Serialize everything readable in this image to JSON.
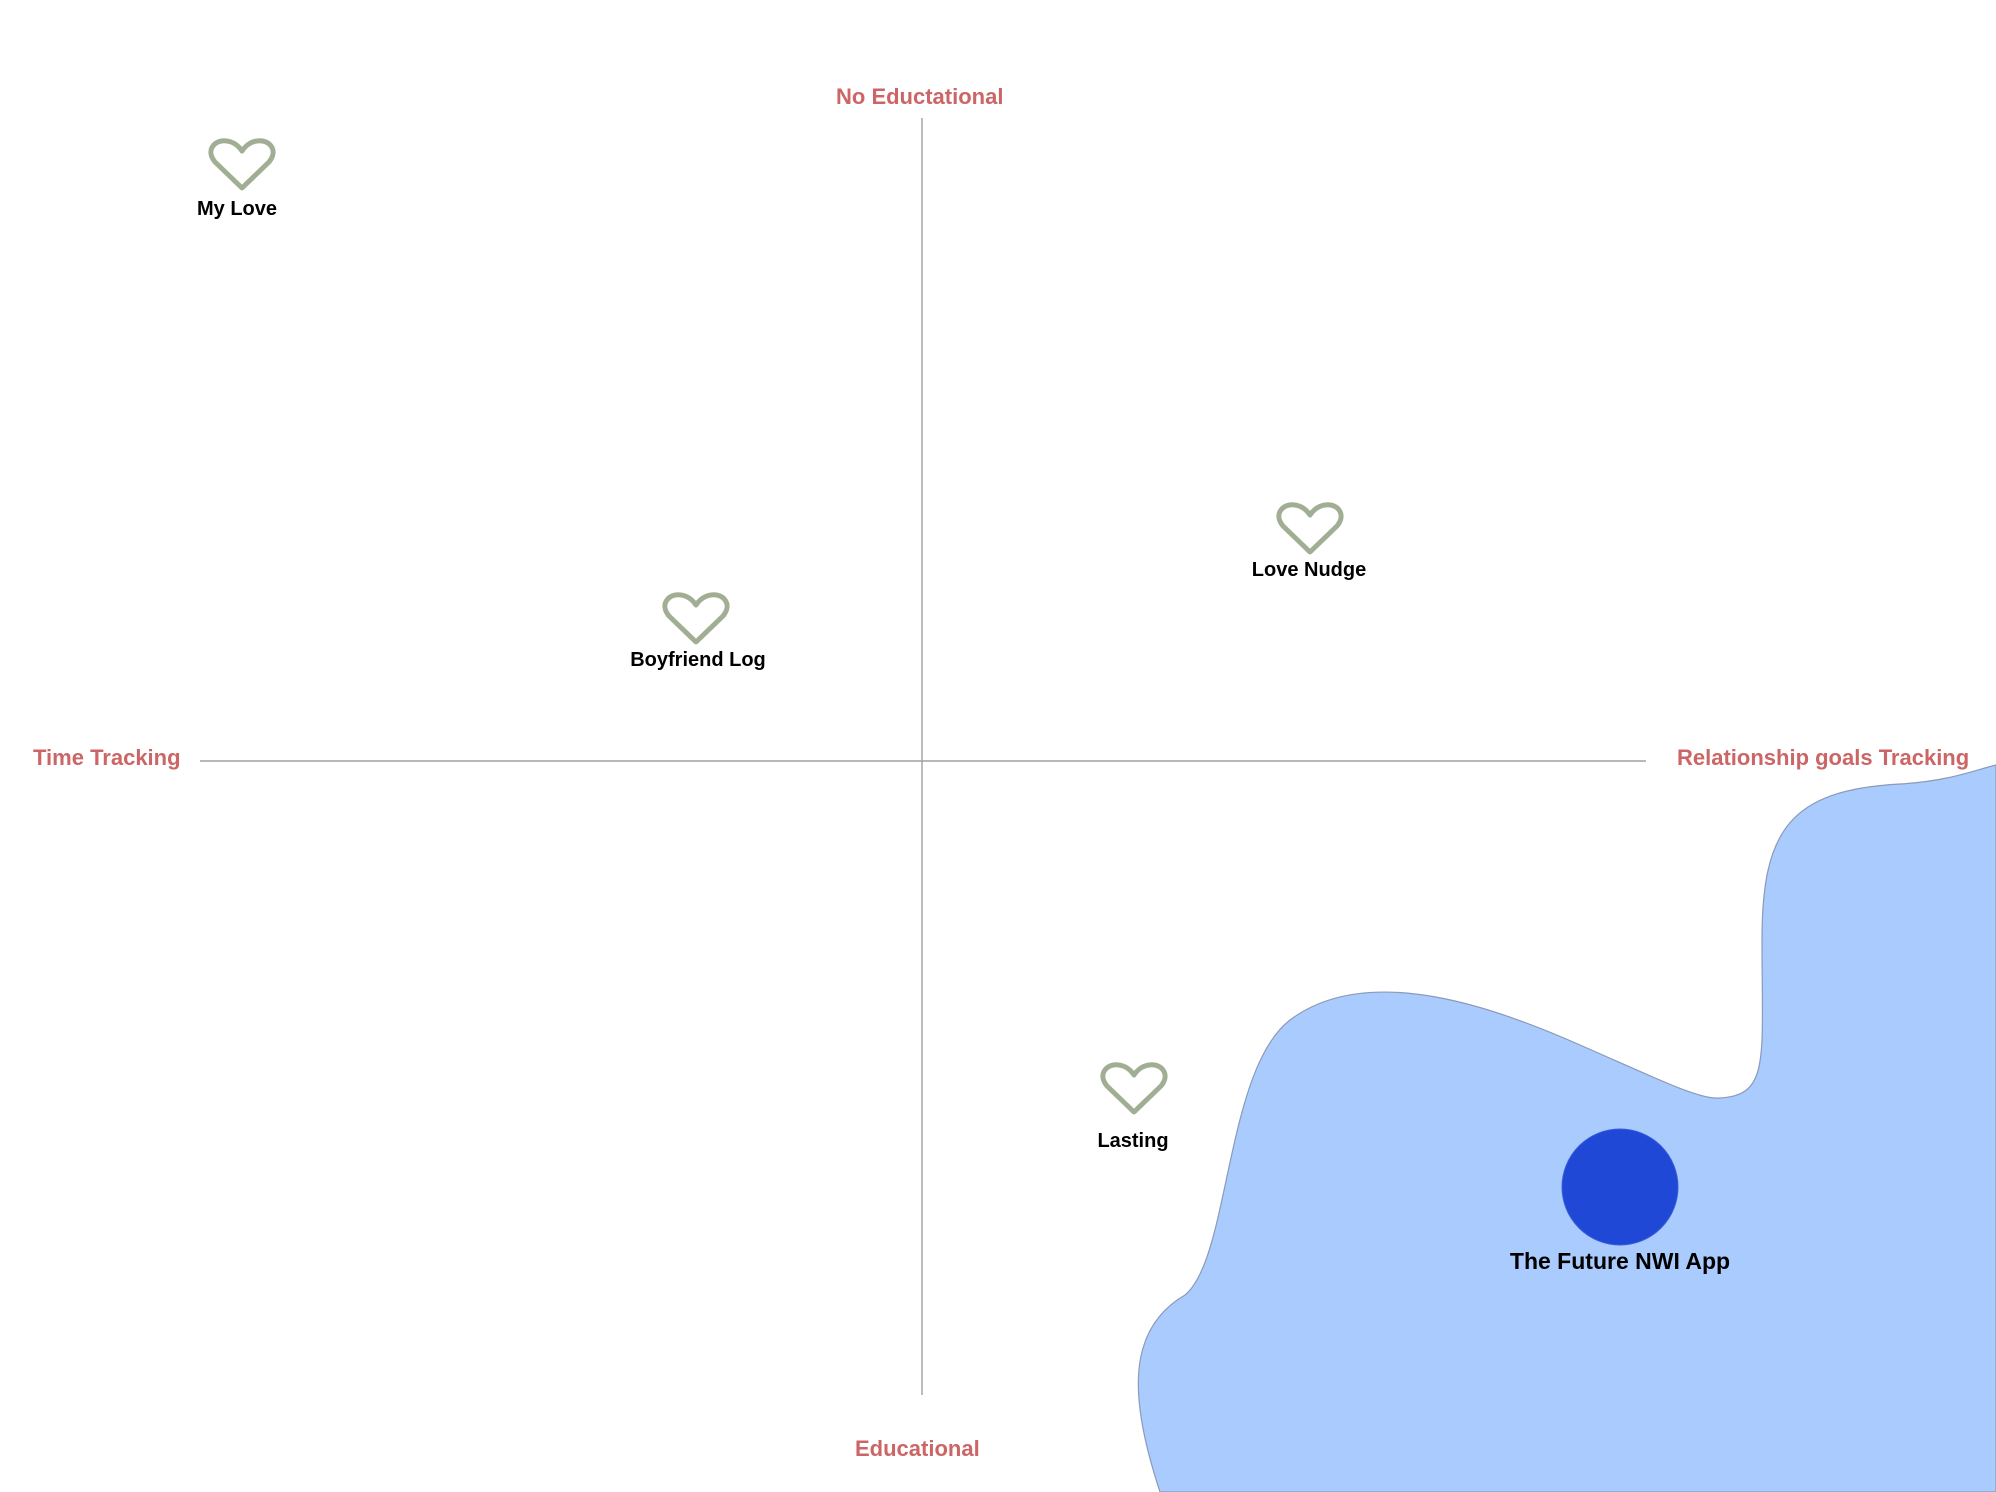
{
  "axes": {
    "top_label": "No Eductational",
    "bottom_label": "Educational",
    "left_label": "Time Tracking",
    "right_label": "Relationship goals Tracking"
  },
  "items": [
    {
      "name": "My Love",
      "icon": "heart-outline-icon"
    },
    {
      "name": "Love Nudge",
      "icon": "heart-outline-icon"
    },
    {
      "name": "Boyfriend Log",
      "icon": "heart-outline-icon"
    },
    {
      "name": "Lasting",
      "icon": "heart-outline-icon"
    }
  ],
  "target": {
    "name": "The Future NWI App",
    "icon": "filled-circle-icon"
  },
  "colors": {
    "axis_label": "#cc6666",
    "axis_line": "#a0a0a0",
    "heart_stroke": "#a2ae94",
    "region_fill": "#aacbfd",
    "region_stroke": "#8a9ab8",
    "target_fill": "#1f48d6"
  }
}
